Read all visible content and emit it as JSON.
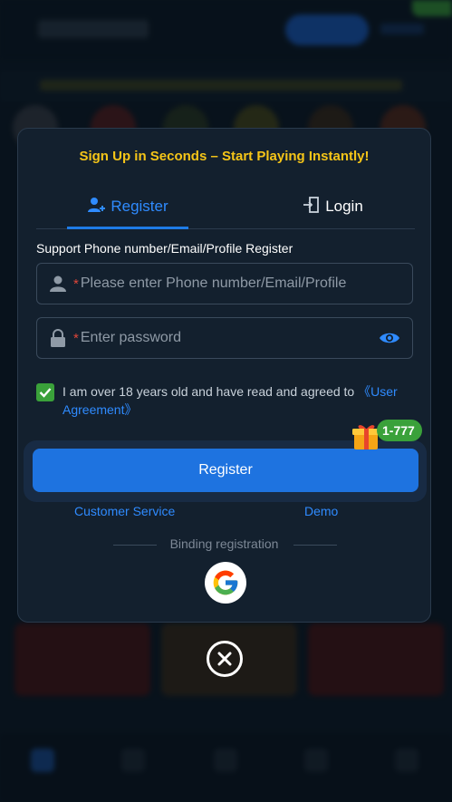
{
  "modal": {
    "headline": "Sign Up in Seconds – Start Playing Instantly!",
    "tabs": [
      {
        "label": "Register",
        "active": true
      },
      {
        "label": "Login",
        "active": false
      }
    ],
    "field_label": "Support Phone number/Email/Profile Register",
    "phone_field": {
      "placeholder": "Please enter Phone number/Email/Profile",
      "value": "",
      "required_mark": "*"
    },
    "password_field": {
      "placeholder": "Enter password",
      "value": "",
      "required_mark": "*"
    },
    "agreement": {
      "checked": true,
      "text": "I am over 18 years old and have read and agreed to ",
      "link": "《User Agreement》"
    },
    "register_button": "Register",
    "bonus_badge": "1-777",
    "links": {
      "customer_service": "Customer Service",
      "demo": "Demo"
    },
    "binding_label": "Binding registration"
  },
  "colors": {
    "accent": "#1e73e0",
    "headline": "#f5c518",
    "success": "#3aa13a",
    "modal_bg": "#13202e"
  },
  "icons": [
    "user-add-icon",
    "login-icon",
    "user-icon",
    "lock-icon",
    "eye-icon",
    "check-icon",
    "gift-icon",
    "google-icon",
    "close-icon"
  ]
}
